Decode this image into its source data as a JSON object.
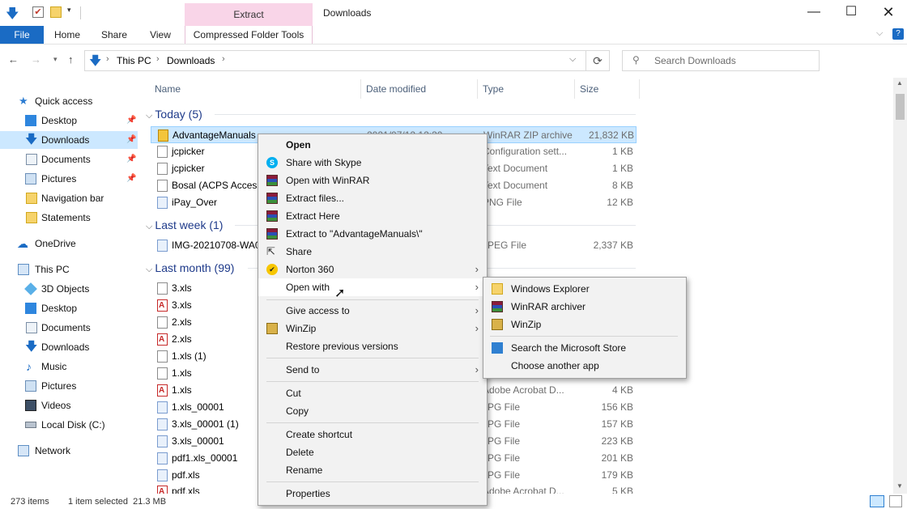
{
  "window": {
    "title": "Downloads",
    "contextual_group": "Extract",
    "contextual_tab": "Compressed Folder Tools",
    "tabs": [
      "File",
      "Home",
      "Share",
      "View"
    ]
  },
  "address": {
    "crumbs": [
      "This PC",
      "Downloads"
    ],
    "search_placeholder": "Search Downloads"
  },
  "nav": {
    "quick_access": "Quick access",
    "quick_items": [
      "Desktop",
      "Downloads",
      "Documents",
      "Pictures",
      "Navigation bar",
      "Statements"
    ],
    "onedrive": "OneDrive",
    "this_pc": "This PC",
    "pc_items": [
      "3D Objects",
      "Desktop",
      "Documents",
      "Downloads",
      "Music",
      "Pictures",
      "Videos",
      "Local Disk (C:)"
    ],
    "network": "Network"
  },
  "columns": {
    "name": "Name",
    "date": "Date modified",
    "type": "Type",
    "size": "Size"
  },
  "groups": [
    {
      "label": "Today (5)"
    },
    {
      "label": "Last week (1)"
    },
    {
      "label": "Last month (99)"
    }
  ],
  "files": [
    {
      "name": "AdvantageManuals",
      "date": "2021/07/12 12:30",
      "type": "WinRAR ZIP archive",
      "size": "21,832 KB"
    },
    {
      "name": "jcpicker",
      "date": "",
      "type": "Configuration sett...",
      "size": "1 KB"
    },
    {
      "name": "jcpicker",
      "date": "",
      "type": "Text Document",
      "size": "1 KB"
    },
    {
      "name": "Bosal (ACPS Accesso",
      "date": "",
      "type": "Text Document",
      "size": "8 KB"
    },
    {
      "name": "iPay_Over",
      "date": "",
      "type": "PNG File",
      "size": "12 KB"
    },
    {
      "name": "IMG-20210708-WA00",
      "date": "",
      "type": "JPEG File",
      "size": "2,337 KB"
    },
    {
      "name": "3.xls",
      "date": "",
      "type": "",
      "size": ""
    },
    {
      "name": "3.xls",
      "date": "",
      "type": "",
      "size": ""
    },
    {
      "name": "2.xls",
      "date": "",
      "type": "",
      "size": ""
    },
    {
      "name": "2.xls",
      "date": "",
      "type": "",
      "size": ""
    },
    {
      "name": "1.xls (1)",
      "date": "",
      "type": "",
      "size": ""
    },
    {
      "name": "1.xls",
      "date": "",
      "type": "",
      "size": ""
    },
    {
      "name": "1.xls",
      "date": "",
      "type": "Adobe Acrobat D...",
      "size": "4 KB"
    },
    {
      "name": "1.xls_00001",
      "date": "",
      "type": "JPG File",
      "size": "156 KB"
    },
    {
      "name": "3.xls_00001 (1)",
      "date": "",
      "type": "JPG File",
      "size": "157 KB"
    },
    {
      "name": "3.xls_00001",
      "date": "",
      "type": "JPG File",
      "size": "223 KB"
    },
    {
      "name": "pdf1.xls_00001",
      "date": "",
      "type": "JPG File",
      "size": "201 KB"
    },
    {
      "name": "pdf.xls",
      "date": "",
      "type": "JPG File",
      "size": "179 KB"
    },
    {
      "name": "pdf.xls",
      "date": "",
      "type": "Adobe Acrobat D...",
      "size": "5 KB"
    }
  ],
  "context_menu": [
    "Open",
    "Share with Skype",
    "Open with WinRAR",
    "Extract files...",
    "Extract Here",
    "Extract to \"AdvantageManuals\\\"",
    "Share",
    "Norton 360",
    "Open with",
    "Give access to",
    "WinZip",
    "Restore previous versions",
    "Send to",
    "Cut",
    "Copy",
    "Create shortcut",
    "Delete",
    "Rename",
    "Properties"
  ],
  "open_with_menu": [
    "Windows Explorer",
    "WinRAR archiver",
    "WinZip",
    "Search the Microsoft Store",
    "Choose another app"
  ],
  "status": {
    "items": "273 items",
    "selected": "1 item selected  21.3 MB"
  },
  "colors": {
    "accent": "#1a6bc4",
    "selection": "#cce8ff",
    "extract_tab": "#f9d5e8"
  }
}
